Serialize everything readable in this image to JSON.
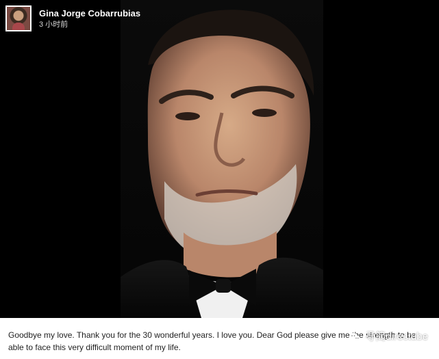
{
  "post": {
    "author": "Gina Jorge Cobarrubias",
    "timestamp": "3 小时前",
    "avatar_icon": "profile-avatar",
    "caption": "Goodbye my love. Thank you for the 30 wonderful years. I love you. Dear God please give me the strength to be able to face this very difficult moment of my life."
  },
  "watermark": {
    "text": "寻简directube",
    "icon": "wechat-icon"
  },
  "colors": {
    "media_background": "#000000",
    "author_text": "#ffffff",
    "timestamp_text": "#d7d7d7",
    "caption_text": "#1f1f1f"
  }
}
